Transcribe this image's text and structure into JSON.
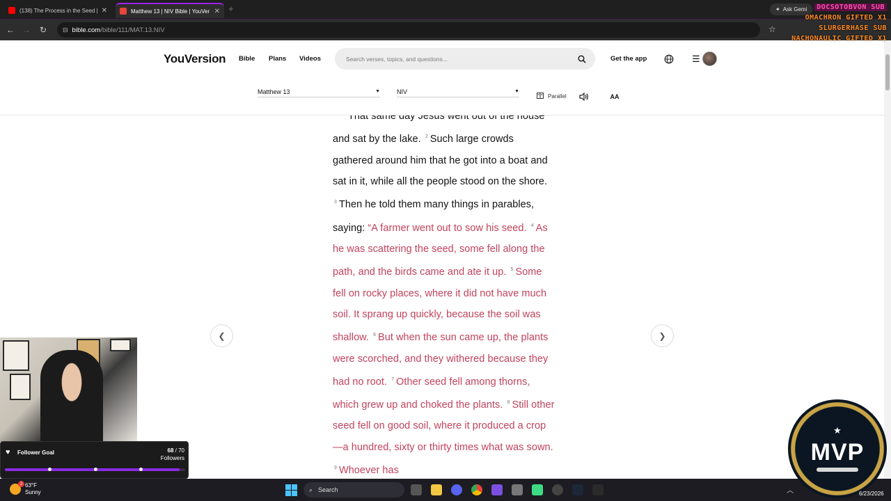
{
  "browser": {
    "tabs": [
      {
        "title": "(138) The Process in the Seed |",
        "favicon_color": "#ff0000",
        "active": false
      },
      {
        "title": "Matthew 13 | NIV Bible | YouVer",
        "favicon_color": "#e8453c",
        "active": true
      }
    ],
    "ask_gemini": "Ask Gemi",
    "url_domain": "bible.com",
    "url_path": "/bible/111/MAT.13.NIV"
  },
  "stream_overlay": {
    "lines": [
      "DOCSOTOBVON SUB",
      "OMACHRON GIFTED X1",
      "SLURGERHASE SUB",
      "NACHONAULIC GIFTED X1"
    ]
  },
  "header": {
    "logo": "YouVersion",
    "nav": [
      "Bible",
      "Plans",
      "Videos"
    ],
    "search_placeholder": "Search verses, topics, and questions...",
    "get_app": "Get the app"
  },
  "toolbar": {
    "chapter": "Matthew 13",
    "version": "NIV",
    "parallel": "Parallel",
    "font_size": "AA"
  },
  "passage": {
    "v1": "That same day Jesus went out of the house and sat by the lake.",
    "v2n": "2",
    "v2": "Such large crowds gathered around him that he got into a boat and sat in it, while all the people stood on the shore.",
    "v3n": "3",
    "v3a": "Then he told them many things in parables, saying:",
    "v3b": "“A farmer went out to sow his seed.",
    "v4n": "4",
    "v4": "As he was scattering the seed, some fell along the path, and the birds came and ate it up.",
    "v5n": "5",
    "v5": "Some fell on rocky places, where it did not have much soil. It sprang up quickly, because the soil was shallow.",
    "v6n": "6",
    "v6": "But when the sun came up, the plants were scorched, and they withered because they had no root.",
    "v7n": "7",
    "v7": "Other seed fell among thorns, which grew up and choked the plants.",
    "v8n": "8",
    "v8": "Still other seed fell on good soil, where it produced a crop—a hundred, sixty or thirty times what was sown.",
    "v9n": "9",
    "v9": "Whoever has"
  },
  "follower_goal": {
    "label": "Follower Goal",
    "current": "68",
    "sep": " / 70",
    "unit": "Followers",
    "progress": 0.97
  },
  "mvp_badge": {
    "text": "MVP"
  },
  "taskbar": {
    "temp": "63°F",
    "condition": "Sunny",
    "weather_badge": "2",
    "search": "Search",
    "date": "6/23/2026"
  },
  "colors": {
    "words_of_jesus": "#c2425c",
    "accent": "#8a2be2"
  }
}
